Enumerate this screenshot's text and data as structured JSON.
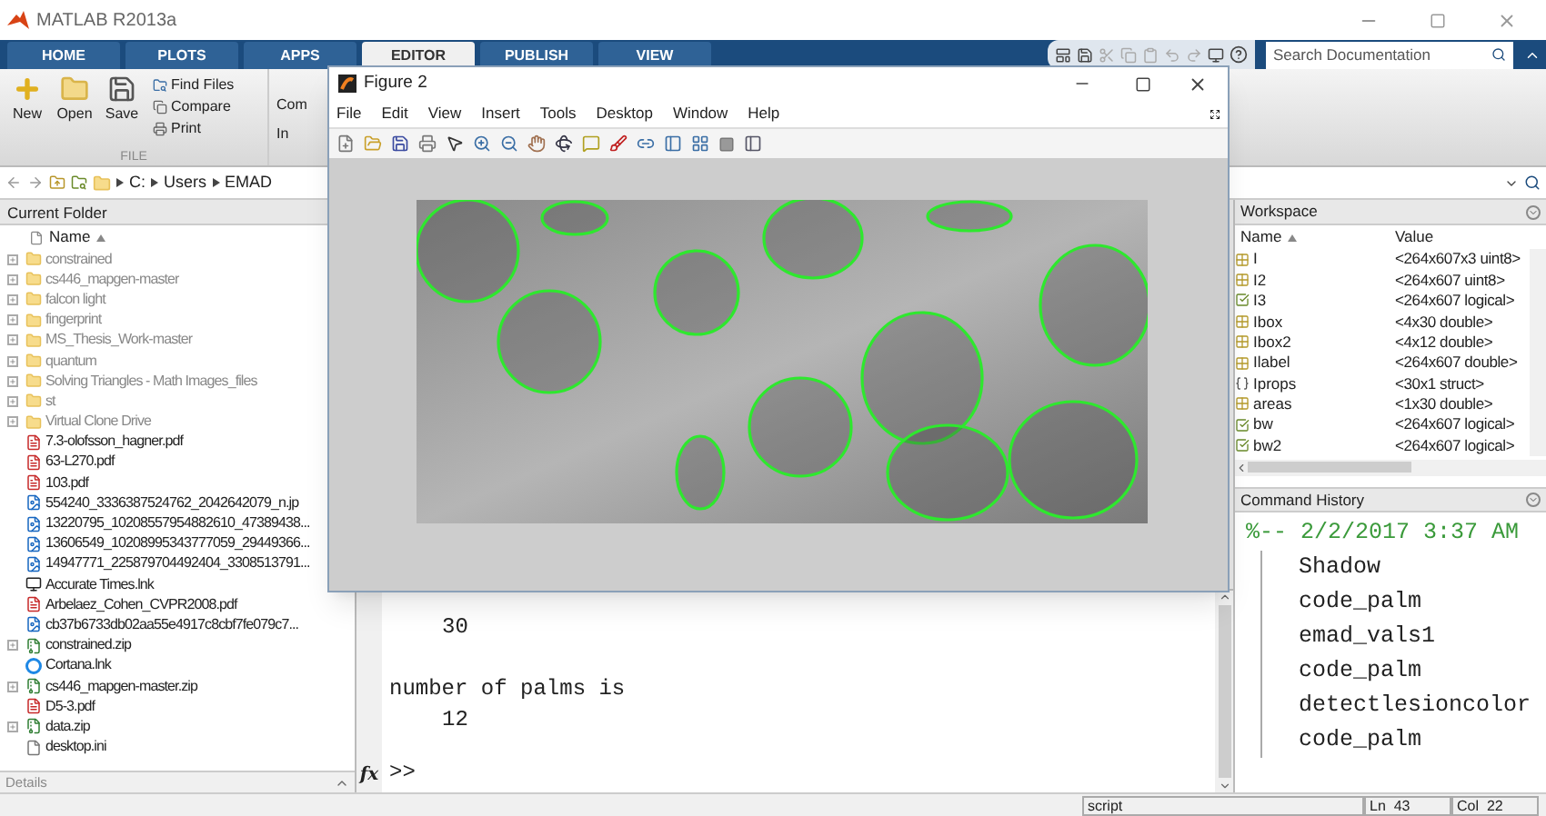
{
  "window": {
    "title": "MATLAB R2013a"
  },
  "tabs": [
    {
      "label": "HOME",
      "selected": false
    },
    {
      "label": "PLOTS",
      "selected": false
    },
    {
      "label": "APPS",
      "selected": false
    },
    {
      "label": "EDITOR",
      "selected": true
    },
    {
      "label": "PUBLISH",
      "selected": false
    },
    {
      "label": "VIEW",
      "selected": false
    }
  ],
  "search": {
    "placeholder": "Search Documentation"
  },
  "ribbon": {
    "large_buttons": [
      {
        "label": "New",
        "kind": "new"
      },
      {
        "label": "Open",
        "kind": "open"
      },
      {
        "label": "Save",
        "kind": "save"
      }
    ],
    "small_buttons": [
      {
        "label": "Find Files",
        "kind": "find"
      },
      {
        "label": "Compare",
        "kind": "compare"
      },
      {
        "label": "Print",
        "kind": "print"
      }
    ],
    "section_label": "FILE",
    "cut_labels": [
      "Com",
      "In"
    ]
  },
  "address_bar": {
    "path": [
      "C:",
      "Users",
      "EMAD"
    ]
  },
  "current_folder": {
    "title": "Current Folder",
    "column": "Name",
    "details": "Details",
    "files": [
      {
        "name": "constrained",
        "kind": "folder"
      },
      {
        "name": "cs446_mapgen-master",
        "kind": "folder"
      },
      {
        "name": "falcon light",
        "kind": "folder"
      },
      {
        "name": "fingerprint",
        "kind": "folder"
      },
      {
        "name": "MS_Thesis_Work-master",
        "kind": "folder"
      },
      {
        "name": "quantum",
        "kind": "folder"
      },
      {
        "name": "Solving Triangles - Math Images_files",
        "kind": "folder"
      },
      {
        "name": "st",
        "kind": "folder"
      },
      {
        "name": "Virtual Clone Drive",
        "kind": "folder"
      },
      {
        "name": "7.3-olofsson_hagner.pdf",
        "kind": "pdf"
      },
      {
        "name": "63-L270.pdf",
        "kind": "pdf"
      },
      {
        "name": "103.pdf",
        "kind": "pdf"
      },
      {
        "name": "554240_3336387524762_2042642079_n.jp",
        "kind": "image"
      },
      {
        "name": "13220795_10208557954882610_47389438...",
        "kind": "image"
      },
      {
        "name": "13606549_10208995343777059_29449366...",
        "kind": "image"
      },
      {
        "name": "14947771_225879704492404_3308513791...",
        "kind": "image"
      },
      {
        "name": "Accurate Times.lnk",
        "kind": "app"
      },
      {
        "name": "Arbelaez_Cohen_CVPR2008.pdf",
        "kind": "pdf"
      },
      {
        "name": "cb37b6733db02aa55e4917c8cbf7fe079c7...",
        "kind": "image"
      },
      {
        "name": "constrained.zip",
        "kind": "zip"
      },
      {
        "name": "Cortana.lnk",
        "kind": "cortana"
      },
      {
        "name": "cs446_mapgen-master.zip",
        "kind": "zip"
      },
      {
        "name": "D5-3.pdf",
        "kind": "pdf"
      },
      {
        "name": "data.zip",
        "kind": "zip"
      },
      {
        "name": "desktop.ini",
        "kind": "ini"
      }
    ]
  },
  "command_window": {
    "lines": [
      {
        "text": "30",
        "kind": "value"
      },
      {
        "text": "number of palms is",
        "kind": "label"
      },
      {
        "text": "12",
        "kind": "value"
      }
    ],
    "prompt": ">>",
    "function_label": "fx"
  },
  "workspace": {
    "title": "Workspace",
    "columns": [
      "Name",
      "Value"
    ],
    "rows": [
      {
        "name": "I",
        "value": "<264x607x3 uint8>",
        "kind": "matrix"
      },
      {
        "name": "I2",
        "value": "<264x607 uint8>",
        "kind": "matrix"
      },
      {
        "name": "I3",
        "value": "<264x607 logical>",
        "kind": "logical"
      },
      {
        "name": "Ibox",
        "value": "<4x30 double>",
        "kind": "matrix"
      },
      {
        "name": "Ibox2",
        "value": "<4x12 double>",
        "kind": "matrix"
      },
      {
        "name": "Ilabel",
        "value": "<264x607 double>",
        "kind": "matrix"
      },
      {
        "name": "Iprops",
        "value": "<30x1 struct>",
        "kind": "struct"
      },
      {
        "name": "areas",
        "value": "<1x30 double>",
        "kind": "matrix"
      },
      {
        "name": "bw",
        "value": "<264x607 logical>",
        "kind": "logical"
      },
      {
        "name": "bw2",
        "value": "<264x607 logical>",
        "kind": "logical"
      }
    ]
  },
  "command_history": {
    "title": "Command History",
    "session": "%-- 2/2/2017 3:37 AM",
    "entries": [
      "Shadow",
      "code_palm",
      "emad_vals1",
      "code_palm",
      "detectlesioncolor",
      "code_palm"
    ]
  },
  "figure": {
    "title": "Figure 2",
    "menu": [
      "File",
      "Edit",
      "View",
      "Insert",
      "Tools",
      "Desktop",
      "Window",
      "Help"
    ]
  },
  "status_bar": {
    "mode": "script",
    "line": "Ln  43",
    "col": "Col  22"
  }
}
